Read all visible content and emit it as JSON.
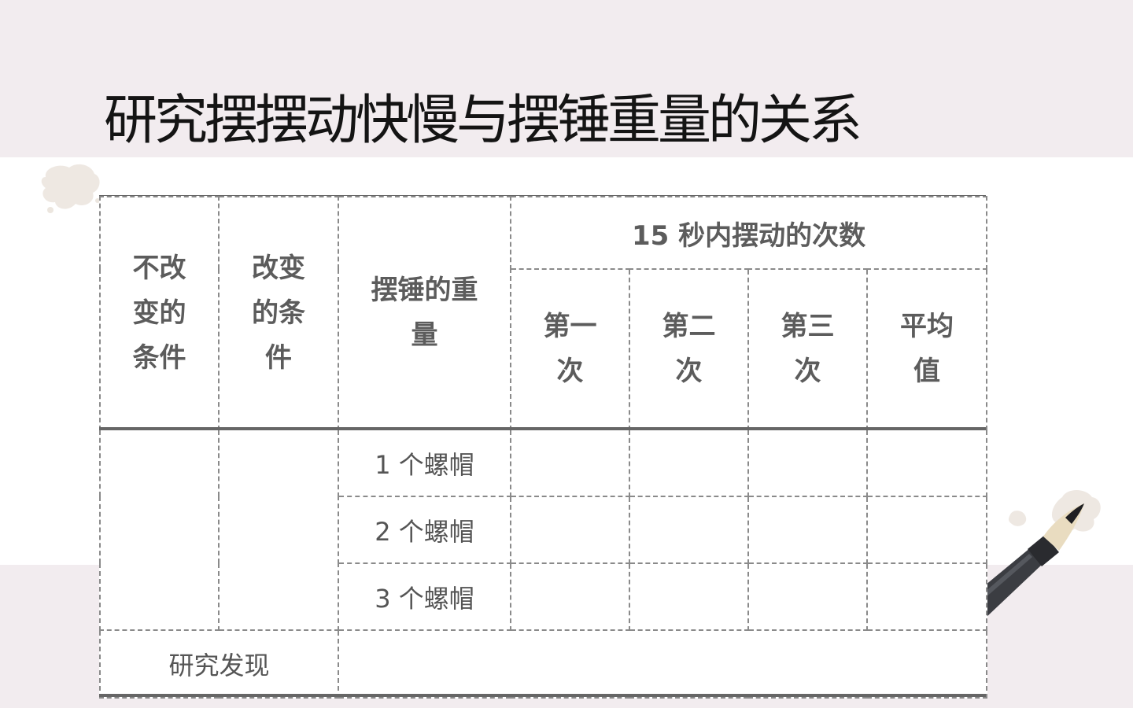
{
  "title": "研究摆摆动快慢与摆锤重量的关系",
  "table": {
    "headers": {
      "unchanged_conditions": "不改变的条件",
      "changed_conditions": "改变的条件",
      "pendulum_weight": "摆锤的重量",
      "swings_in_15s": "15 秒内摆动的次数",
      "first": "第一次",
      "second": "第二次",
      "third": "第三次",
      "average": "平均值"
    },
    "rows": [
      {
        "weight": "1 个螺帽"
      },
      {
        "weight": "2 个螺帽"
      },
      {
        "weight": "3 个螺帽"
      }
    ],
    "findings_label": "研究发现"
  },
  "decor": {
    "band_color": "#f2ecef",
    "rule_color": "#666666",
    "dash_color": "#8a8a8a",
    "icons": [
      "ink-blot",
      "brush-pen"
    ]
  }
}
